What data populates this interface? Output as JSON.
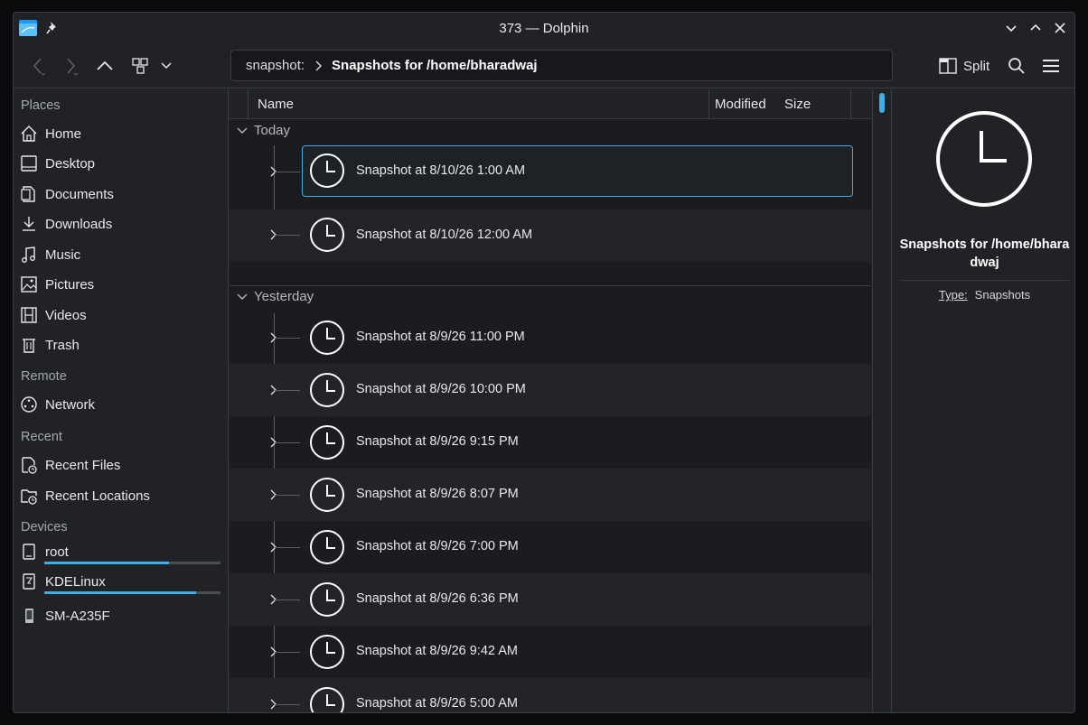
{
  "window": {
    "title": "373 — Dolphin"
  },
  "toolbar": {
    "breadcrumb_root": "snapshot:",
    "breadcrumb_current": "Snapshots for /home/bharadwaj",
    "split_label": "Split"
  },
  "sidebar": {
    "places_heading": "Places",
    "places": [
      {
        "label": "Home",
        "icon": "home-icon"
      },
      {
        "label": "Desktop",
        "icon": "desktop-icon"
      },
      {
        "label": "Documents",
        "icon": "documents-icon"
      },
      {
        "label": "Downloads",
        "icon": "downloads-icon"
      },
      {
        "label": "Music",
        "icon": "music-icon"
      },
      {
        "label": "Pictures",
        "icon": "pictures-icon"
      },
      {
        "label": "Videos",
        "icon": "videos-icon"
      },
      {
        "label": "Trash",
        "icon": "trash-icon"
      }
    ],
    "remote_heading": "Remote",
    "remote": [
      {
        "label": "Network",
        "icon": "network-icon"
      }
    ],
    "recent_heading": "Recent",
    "recent": [
      {
        "label": "Recent Files",
        "icon": "recent-files-icon"
      },
      {
        "label": "Recent Locations",
        "icon": "recent-locations-icon"
      }
    ],
    "devices_heading": "Devices",
    "devices": [
      {
        "label": "root",
        "icon": "drive-icon",
        "usage": 0.71
      },
      {
        "label": "KDELinux",
        "icon": "drive-icon",
        "usage": 0.86
      },
      {
        "label": "SM-A235F",
        "icon": "phone-icon"
      }
    ]
  },
  "columns": {
    "name": "Name",
    "modified": "Modified",
    "size": "Size"
  },
  "groups": [
    {
      "label": "Today",
      "items": [
        "Snapshot at 8/10/26 1:00 AM",
        "Snapshot at 8/10/26 12:00 AM"
      ]
    },
    {
      "label": "Yesterday",
      "items": [
        "Snapshot at 8/9/26 11:00 PM",
        "Snapshot at 8/9/26 10:00 PM",
        "Snapshot at 8/9/26 9:15 PM",
        "Snapshot at 8/9/26 8:07 PM",
        "Snapshot at 8/9/26 7:00 PM",
        "Snapshot at 8/9/26 6:36 PM",
        "Snapshot at 8/9/26 9:42 AM",
        "Snapshot at 8/9/26 5:00 AM"
      ]
    }
  ],
  "info_panel": {
    "title": "Snapshots for /home/bharadwaj",
    "type_label": "Type:",
    "type_value": "Snapshots"
  },
  "colors": {
    "accent": "#3daee9",
    "background": "#1b1c1f",
    "panel": "#202226"
  }
}
